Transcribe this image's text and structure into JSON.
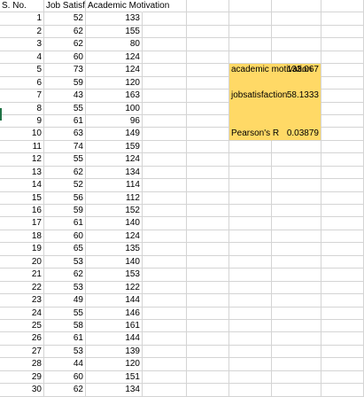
{
  "sheet": {
    "headers": {
      "sno": "S. No.",
      "job": "Job Satisfactic",
      "academic": "Academic Motivation"
    },
    "rows": [
      {
        "sno": "1",
        "job": "52",
        "academic": "133"
      },
      {
        "sno": "2",
        "job": "62",
        "academic": "155"
      },
      {
        "sno": "3",
        "job": "62",
        "academic": "80"
      },
      {
        "sno": "4",
        "job": "60",
        "academic": "124"
      },
      {
        "sno": "5",
        "job": "73",
        "academic": "124"
      },
      {
        "sno": "6",
        "job": "59",
        "academic": "120"
      },
      {
        "sno": "7",
        "job": "43",
        "academic": "163"
      },
      {
        "sno": "8",
        "job": "55",
        "academic": "100"
      },
      {
        "sno": "9",
        "job": "61",
        "academic": "96"
      },
      {
        "sno": "10",
        "job": "63",
        "academic": "149"
      },
      {
        "sno": "11",
        "job": "74",
        "academic": "159"
      },
      {
        "sno": "12",
        "job": "55",
        "academic": "124"
      },
      {
        "sno": "13",
        "job": "62",
        "academic": "134"
      },
      {
        "sno": "14",
        "job": "52",
        "academic": "114"
      },
      {
        "sno": "15",
        "job": "56",
        "academic": "112"
      },
      {
        "sno": "16",
        "job": "59",
        "academic": "152"
      },
      {
        "sno": "17",
        "job": "61",
        "academic": "140"
      },
      {
        "sno": "18",
        "job": "60",
        "academic": "124"
      },
      {
        "sno": "19",
        "job": "65",
        "academic": "135"
      },
      {
        "sno": "20",
        "job": "53",
        "academic": "140"
      },
      {
        "sno": "21",
        "job": "62",
        "academic": "153"
      },
      {
        "sno": "22",
        "job": "53",
        "academic": "122"
      },
      {
        "sno": "23",
        "job": "49",
        "academic": "144"
      },
      {
        "sno": "24",
        "job": "55",
        "academic": "146"
      },
      {
        "sno": "25",
        "job": "58",
        "academic": "161"
      },
      {
        "sno": "26",
        "job": "61",
        "academic": "144"
      },
      {
        "sno": "27",
        "job": "53",
        "academic": "139"
      },
      {
        "sno": "28",
        "job": "44",
        "academic": "120"
      },
      {
        "sno": "29",
        "job": "60",
        "academic": "151"
      },
      {
        "sno": "30",
        "job": "62",
        "academic": "134"
      }
    ],
    "summary": [
      {
        "label": "academic motivation",
        "value": "133.067"
      },
      {
        "label": "jobsatisfaction",
        "value": "58.1333"
      },
      {
        "label": "Pearson's R",
        "value": "0.03879"
      }
    ],
    "highlight_color": "#ffd966"
  }
}
